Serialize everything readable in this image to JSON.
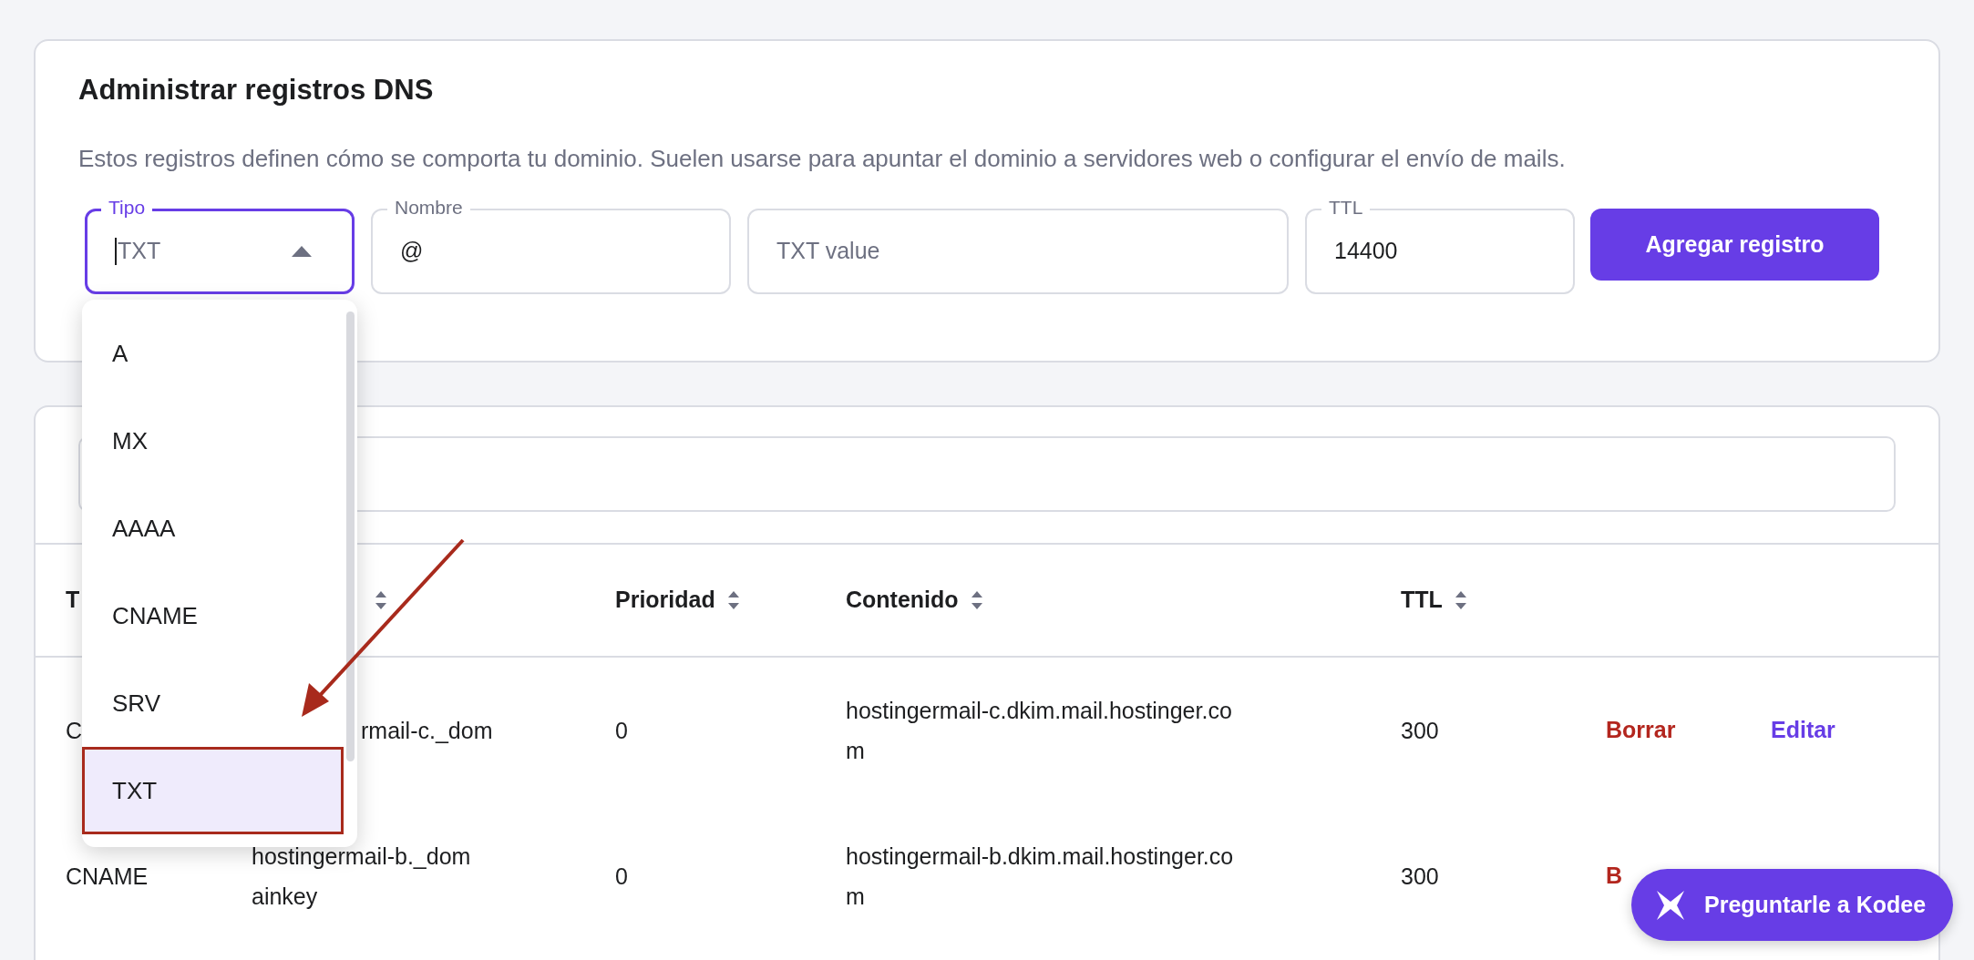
{
  "header_card": {
    "title": "Administrar registros DNS",
    "description": "Estos registros definen cómo se comporta tu dominio. Suelen usarse para apuntar el dominio a servidores web o configurar el envío de mails."
  },
  "form": {
    "fields": [
      {
        "kind": "select",
        "label": "Tipo",
        "value": "TXT",
        "focused": true,
        "expanded": true
      },
      {
        "kind": "text",
        "label": "Nombre",
        "value": "@",
        "focused": false
      },
      {
        "kind": "text",
        "placeholder": "TXT value",
        "focused": false
      },
      {
        "kind": "text",
        "label": "TTL",
        "value": "14400",
        "focused": false
      }
    ],
    "submit": "Agregar registro"
  },
  "dropdown": {
    "options": [
      {
        "label": "A",
        "selected": false
      },
      {
        "label": "MX",
        "selected": false
      },
      {
        "label": "AAAA",
        "selected": false
      },
      {
        "label": "CNAME",
        "selected": false
      },
      {
        "label": "SRV",
        "selected": false
      },
      {
        "label": "TXT",
        "selected": true
      }
    ]
  },
  "table": {
    "columns": [
      {
        "label": "T",
        "sortable": false
      },
      {
        "sortable": true
      },
      {
        "label": "Prioridad",
        "sortable": true
      },
      {
        "label": "Contenido",
        "sortable": true
      },
      {
        "label": "TTL",
        "sortable": true
      }
    ],
    "rows": [
      {
        "cells": [
          [
            "C"
          ],
          [
            "rmail-c._dom"
          ],
          [
            "0"
          ],
          [
            "hostingermail-c.dkim.mail.hostinger.co",
            "m"
          ],
          [
            "300"
          ]
        ],
        "actions": [
          {
            "kind": "delete",
            "label": "Borrar"
          },
          {
            "kind": "edit",
            "label": "Editar"
          }
        ]
      },
      {
        "cells": [
          [
            "CNAME"
          ],
          [
            "hostingermail-b._dom",
            "ainkey"
          ],
          [
            "0"
          ],
          [
            "hostingermail-b.dkim.mail.hostinger.co",
            "m"
          ],
          [
            "300"
          ]
        ],
        "actions": [
          {
            "kind": "delete",
            "label": "B"
          }
        ]
      }
    ]
  },
  "assistant_button": {
    "label": "Preguntarle a Kodee"
  }
}
